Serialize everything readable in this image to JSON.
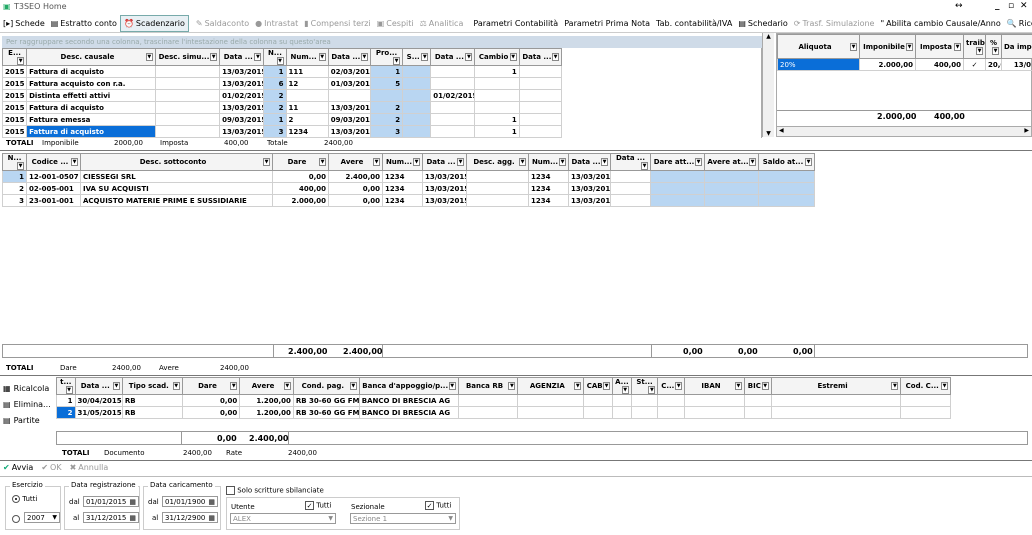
{
  "window": {
    "title": "T3SEO Home",
    "controls": [
      "↔",
      "_",
      "▫",
      "✕"
    ]
  },
  "toolbar": {
    "items": [
      {
        "label": "Schede",
        "icon": "[▸]",
        "state": "normal"
      },
      {
        "label": "Estratto conto",
        "icon": "▤",
        "state": "normal"
      },
      {
        "label": "Scadenzario",
        "icon": "⏰",
        "state": "active"
      },
      {
        "label": "Saldaconto",
        "icon": "✎",
        "state": "disabled"
      },
      {
        "label": "Intrastat",
        "icon": "●",
        "state": "disabled"
      },
      {
        "label": "Compensi terzi",
        "icon": "▮",
        "state": "disabled"
      },
      {
        "label": "Cespiti",
        "icon": "▣",
        "state": "disabled"
      },
      {
        "label": "Analitica",
        "icon": "⚖",
        "state": "disabled"
      },
      {
        "label": "Parametri Contabilità",
        "icon": "",
        "state": "normal"
      },
      {
        "label": "Parametri Prima Nota",
        "icon": "",
        "state": "normal"
      },
      {
        "label": "Tab. contabilità/IVA",
        "icon": "",
        "state": "normal"
      },
      {
        "label": "Schedario",
        "icon": "▤",
        "state": "normal"
      },
      {
        "label": "Trasf. Simulazione",
        "icon": "⟳",
        "state": "disabled"
      },
      {
        "label": "Abilita cambio Causale/Anno",
        "icon": "\"",
        "state": "normal"
      },
      {
        "label": "Ricerca protocollo",
        "icon": "🔍",
        "state": "normal"
      }
    ]
  },
  "group_hint": "Per raggruppare secondo una colonna, trascinare l'intestazione della colonna su questo'area",
  "grid1": {
    "headers": [
      "E...",
      "Desc. causale",
      "Desc. simu...",
      "Data ...",
      "N...",
      "Num...",
      "Data ...",
      "Pro...",
      "S...",
      "Data ...",
      "Cambio",
      "Data ..."
    ],
    "rows": [
      [
        "2015",
        "Fattura di acquisto",
        "",
        "13/03/2015",
        "1",
        "111",
        "02/03/2015",
        "1",
        "",
        "",
        "1",
        ""
      ],
      [
        "2015",
        "Fattura acquisto con r.a.",
        "",
        "13/03/2015",
        "6",
        "12",
        "01/03/2015",
        "5",
        "",
        "",
        "",
        ""
      ],
      [
        "2015",
        "Distinta effetti attivi",
        "",
        "01/02/2015",
        "2",
        "",
        "",
        "",
        "",
        "01/02/2015",
        "",
        ""
      ],
      [
        "2015",
        "Fattura di acquisto",
        "",
        "13/03/2015",
        "2",
        "11",
        "13/03/2015",
        "2",
        "",
        "",
        "",
        ""
      ],
      [
        "2015",
        "Fattura emessa",
        "",
        "09/03/2015",
        "1",
        "2",
        "09/03/2015",
        "2",
        "",
        "",
        "1",
        ""
      ],
      [
        "2015",
        "Fattura di acquisto",
        "",
        "13/03/2015",
        "3",
        "1234",
        "13/03/2015",
        "3",
        "",
        "",
        "1",
        ""
      ]
    ],
    "selected_row": 5
  },
  "iva": {
    "headers": [
      "Aliquota",
      "Imponibile",
      "Imposta",
      "traib",
      "%",
      "Da impe"
    ],
    "row": [
      "20%",
      "2.000,00",
      "400,00",
      "✓",
      "20,0",
      "13/0"
    ],
    "totals": [
      "2.000,00",
      "400,00"
    ]
  },
  "totals1": {
    "label": "TOTALI",
    "imponibile_label": "Imponibile",
    "imponibile": "2000,00",
    "imposta_label": "Imposta",
    "imposta": "400,00",
    "totale_label": "Totale",
    "totale": "2400,00"
  },
  "grid2": {
    "headers": [
      "N...",
      "Codice ...",
      "Desc. sottoconto",
      "Dare",
      "Avere",
      "Num...",
      "Data ...",
      "Desc. agg.",
      "Num...",
      "Data ...",
      "Data ...",
      "Dare att...",
      "Avere at...",
      "Saldo at..."
    ],
    "rows": [
      [
        "1",
        "12-001-0507",
        "CIESSEGI SRL",
        "0,00",
        "2.400,00",
        "1234",
        "13/03/2015",
        "",
        "1234",
        "13/03/2015",
        "",
        "",
        "",
        ""
      ],
      [
        "2",
        "02-005-001",
        "IVA SU ACQUISTI",
        "400,00",
        "0,00",
        "1234",
        "13/03/2015",
        "",
        "1234",
        "13/03/2015",
        "",
        "",
        "",
        ""
      ],
      [
        "3",
        "23-001-001",
        "ACQUISTO MATERIE PRIME E SUSSIDIARIE",
        "2.000,00",
        "0,00",
        "1234",
        "13/03/2015",
        "",
        "1234",
        "13/03/2015",
        "",
        "",
        "",
        ""
      ]
    ],
    "footer": {
      "dare": "2.400,00",
      "avere": "2.400,00",
      "dare_att": "0,00",
      "avere_att": "0,00",
      "saldo_att": "0,00"
    }
  },
  "totals2": {
    "label": "TOTALI",
    "dare_label": "Dare",
    "dare": "2400,00",
    "avere_label": "Avere",
    "avere": "2400,00"
  },
  "side_buttons": [
    {
      "label": "Ricalcola",
      "icon": "▦"
    },
    {
      "label": "Elimina...",
      "icon": "▤"
    },
    {
      "label": "Partite",
      "icon": "▤"
    }
  ],
  "grid3": {
    "headers": [
      "t...",
      "Data ...",
      "Tipo scad.",
      "Dare",
      "Avere",
      "Cond. pag.",
      "Banca d'appoggio/p...",
      "Banca RB",
      "AGENZIA",
      "CAB",
      "A...",
      "St...",
      "C...",
      "IBAN",
      "BIC",
      "Estremi",
      "Cod. C..."
    ],
    "rows": [
      [
        "1",
        "30/04/2015",
        "RB",
        "0,00",
        "1.200,00",
        "RB 30-60 GG FM",
        "BANCO DI BRESCIA AG",
        "",
        "",
        "",
        "",
        "",
        "",
        "",
        "",
        "",
        ""
      ],
      [
        "2",
        "31/05/2015",
        "RB",
        "0,00",
        "1.200,00",
        "RB 30-60 GG FM",
        "BANCO DI BRESCIA AG",
        "",
        "",
        "",
        "",
        "",
        "",
        "",
        "",
        "",
        ""
      ]
    ],
    "footer": {
      "dare": "0,00",
      "avere": "2.400,00"
    }
  },
  "totals3": {
    "label": "TOTALI",
    "documento_label": "Documento",
    "documento": "2400,00",
    "rate_label": "Rate",
    "rate": "2400,00"
  },
  "actions": [
    {
      "label": "Avvia",
      "icon": "✔",
      "enabled": true
    },
    {
      "label": "OK",
      "icon": "✔",
      "enabled": false
    },
    {
      "label": "Annulla",
      "icon": "✖",
      "enabled": false
    }
  ],
  "filters": {
    "esercizio_label": "Esercizio",
    "tutti_label": "Tutti",
    "year": "2007",
    "data_reg_label": "Data registrazione",
    "dal_label": "dal",
    "al_label": "al",
    "reg_dal": "01/01/2015",
    "reg_al": "31/12/2015",
    "data_car_label": "Data caricamento",
    "car_dal": "01/01/1900",
    "car_al": "31/12/2900",
    "solo_label": "Solo scritture sbilanciate",
    "utente_label": "Utente",
    "utente_tutti": "Tutti",
    "utente": "ALEX",
    "sezionale_label": "Sezionale",
    "sez_tutti": "Tutti",
    "sezionale": "Sezione 1"
  }
}
